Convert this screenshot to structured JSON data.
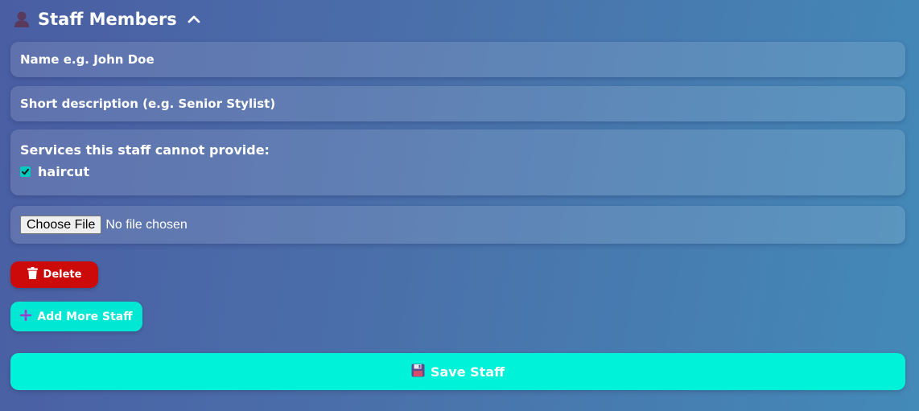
{
  "header": {
    "title": "Staff Members",
    "icon": "person-icon",
    "toggle_icon": "chevron-up-icon"
  },
  "form": {
    "name_placeholder": "Name e.g. John Doe",
    "description_placeholder": "Short description (e.g. Senior Stylist)",
    "services_label": "Services this staff cannot provide:",
    "services": [
      {
        "label": "haircut",
        "checked": true
      }
    ],
    "file": {
      "button_label": "Choose File",
      "status": "No file chosen"
    }
  },
  "actions": {
    "delete_label": "Delete",
    "add_label": "Add More Staff",
    "save_label": "Save Staff"
  },
  "colors": {
    "delete": "#cc0a0a",
    "accent": "#00e8d4",
    "plus_icon": "#9b3fd1"
  }
}
